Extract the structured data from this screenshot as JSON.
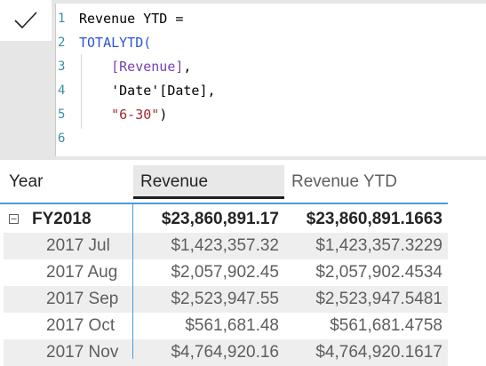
{
  "formula": {
    "lines": [
      {
        "num": "1",
        "tokens": [
          {
            "t": "Revenue YTD =",
            "k": "txt"
          }
        ]
      },
      {
        "num": "2",
        "tokens": [
          {
            "t": "TOTALYTD(",
            "k": "fn"
          }
        ]
      },
      {
        "num": "3",
        "tokens": [
          {
            "t": "    ",
            "k": "txt"
          },
          {
            "t": "[Revenue]",
            "k": "meas"
          },
          {
            "t": ",",
            "k": "txt"
          }
        ]
      },
      {
        "num": "4",
        "tokens": [
          {
            "t": "    'Date'[Date],",
            "k": "txt"
          }
        ]
      },
      {
        "num": "5",
        "tokens": [
          {
            "t": "    ",
            "k": "txt"
          },
          {
            "t": "\"6-30\"",
            "k": "str"
          },
          {
            "t": ")",
            "k": "txt"
          }
        ]
      },
      {
        "num": "6",
        "tokens": []
      }
    ],
    "colors": {
      "function": "#2a55d6",
      "measure": "#7a3fb0",
      "string": "#a3282d",
      "line_number": "#3a8fa5"
    }
  },
  "commit_icon": "checkmark-icon",
  "table": {
    "headers": {
      "year": "Year",
      "revenue": "Revenue",
      "revenue_ytd": "Revenue YTD"
    },
    "total": {
      "year": "FY2018",
      "revenue": "$23,860,891.17",
      "revenue_ytd": "$23,860,891.1663",
      "expand_icon": "collapse-minus-icon"
    },
    "rows": [
      {
        "year": "2017 Jul",
        "revenue": "$1,423,357.32",
        "revenue_ytd": "$1,423,357.3229"
      },
      {
        "year": "2017 Aug",
        "revenue": "$2,057,902.45",
        "revenue_ytd": "$2,057,902.4534"
      },
      {
        "year": "2017 Sep",
        "revenue": "$2,523,947.55",
        "revenue_ytd": "$2,523,947.5481"
      },
      {
        "year": "2017 Oct",
        "revenue": "$561,681.48",
        "revenue_ytd": "$561,681.4758"
      },
      {
        "year": "2017 Nov",
        "revenue": "$4,764,920.16",
        "revenue_ytd": "$4,764,920.1617"
      }
    ],
    "accent": "#4a9ae0"
  }
}
